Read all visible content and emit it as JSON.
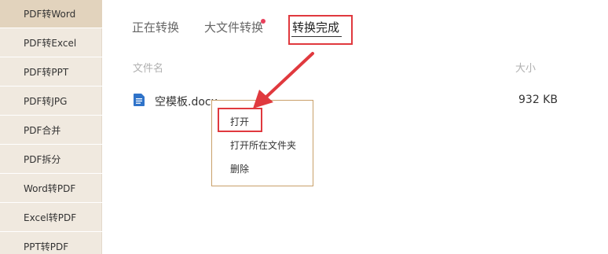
{
  "sidebar": {
    "items": [
      {
        "label": "PDF转Word"
      },
      {
        "label": "PDF转Excel"
      },
      {
        "label": "PDF转PPT"
      },
      {
        "label": "PDF转JPG"
      },
      {
        "label": "PDF合并"
      },
      {
        "label": "PDF拆分"
      },
      {
        "label": "Word转PDF"
      },
      {
        "label": "Excel转PDF"
      },
      {
        "label": "PPT转PDF"
      }
    ]
  },
  "tabs": [
    {
      "label": "正在转换"
    },
    {
      "label": "大文件转换"
    },
    {
      "label": "转换完成"
    }
  ],
  "table": {
    "headers": {
      "name": "文件名",
      "size": "大小"
    },
    "rows": [
      {
        "name": "空模板.docx",
        "size": "932 KB",
        "icon": "document-icon"
      }
    ]
  },
  "context_menu": {
    "items": [
      {
        "label": "打开"
      },
      {
        "label": "打开所在文件夹"
      },
      {
        "label": "删除"
      }
    ]
  },
  "colors": {
    "sidebar_bg": "#f0e9df",
    "sidebar_active_bg": "#e2d3bd",
    "annotation_red": "#e0393e",
    "notification_dot": "#e8405b",
    "menu_border": "#c9a06a",
    "doc_icon_blue": "#2f73c9"
  }
}
